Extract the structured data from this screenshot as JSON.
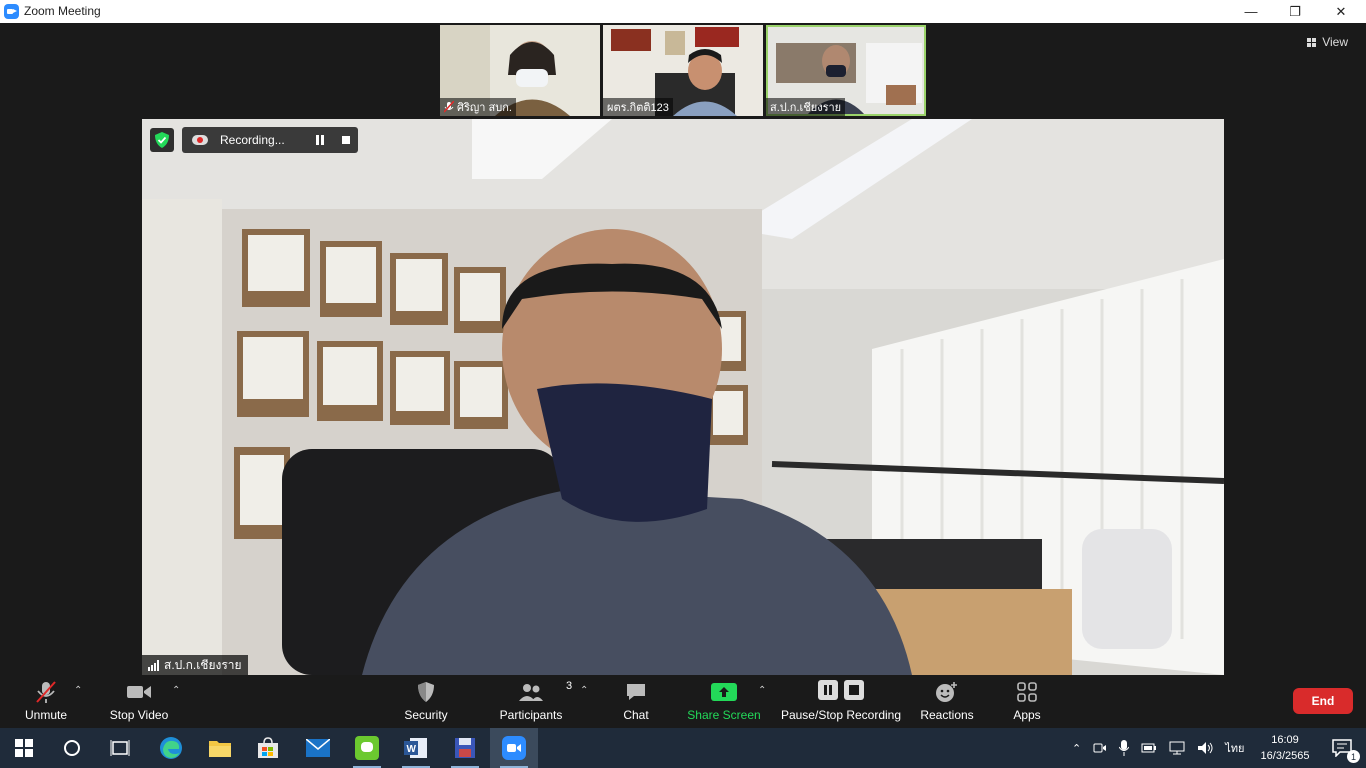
{
  "window": {
    "title": "Zoom Meeting",
    "minimize_glyph": "—",
    "restore_glyph": "❐",
    "close_glyph": "✕"
  },
  "view_button": {
    "label": "View"
  },
  "thumbnails": [
    {
      "name": "ศิริญา สบก.",
      "muted": true
    },
    {
      "name": "ผตร.กิตติ123",
      "muted": false
    },
    {
      "name": "ส.ป.ก.เชียงราย",
      "muted": false,
      "active": true
    }
  ],
  "recording": {
    "label": "Recording..."
  },
  "active_speaker": {
    "name": "ส.ป.ก.เชียงราย"
  },
  "toolbar": {
    "unmute": "Unmute",
    "stop_video": "Stop Video",
    "security": "Security",
    "participants": "Participants",
    "participants_count": "3",
    "chat": "Chat",
    "share_screen": "Share Screen",
    "pause_stop_recording": "Pause/Stop Recording",
    "reactions": "Reactions",
    "apps": "Apps",
    "end": "End"
  },
  "taskbar": {
    "language": "ไทย",
    "time": "16:09",
    "date": "16/3/2565",
    "notification_count": "1"
  },
  "colors": {
    "share_green": "#23d959",
    "end_red": "#d92b2b",
    "taskbar_bg": "#1f2b3a"
  }
}
